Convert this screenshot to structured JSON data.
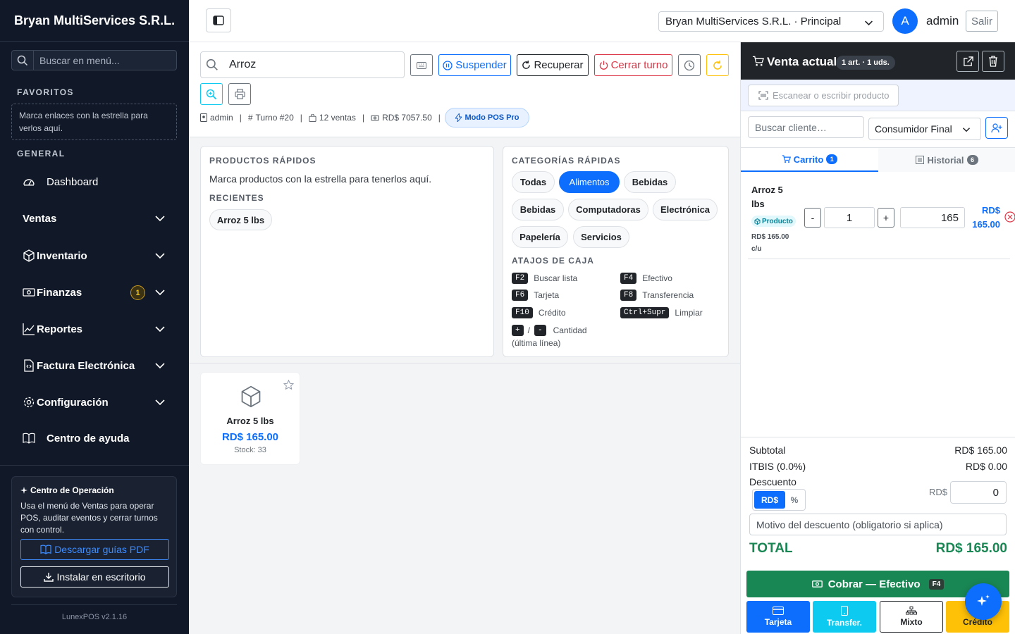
{
  "sidebar": {
    "brand": "Bryan MultiServices S.R.L.",
    "search_placeholder": "Buscar en menú...",
    "favorites_title": "FAVORITOS",
    "favorites_hint": "Marca enlaces con la estrella para verlos aquí.",
    "general_title": "GENERAL",
    "items": [
      {
        "label": "Dashboard",
        "icon": "gauge-icon"
      },
      {
        "label": "Ventas",
        "icon": null
      },
      {
        "label": "Inventario",
        "icon": "box-icon"
      },
      {
        "label": "Finanzas",
        "icon": "cash-icon",
        "badge": "1"
      },
      {
        "label": "Reportes",
        "icon": "chart-line-icon"
      },
      {
        "label": "Factura Electrónica",
        "icon": "file-code-icon"
      },
      {
        "label": "Configuración",
        "icon": "gear-icon"
      },
      {
        "label": "Centro de ayuda",
        "icon": "book-icon"
      }
    ],
    "ops": {
      "title": "Centro de Operación",
      "text": "Usa el menú de Ventas para operar POS, auditar eventos y cerrar turnos con control.",
      "pdf_button": "Descargar guías PDF",
      "install_button": "Instalar en escritorio"
    },
    "version": "LunexPOS v2.1.16"
  },
  "topbar": {
    "company": "Bryan MultiServices S.R.L. · Principal",
    "avatar_letter": "A",
    "user": "admin",
    "logout": "Salir"
  },
  "toolbar": {
    "search_value": "Arroz",
    "suspend": "Suspender",
    "recover": "Recuperar",
    "close_shift": "Cerrar turno",
    "info": {
      "user": "admin",
      "shift": "Turno #20",
      "sales": "12 ventas",
      "amount": "RD$ 7057.50",
      "sep": "|"
    },
    "pro_mode": "Modo POS Pro"
  },
  "quick_products": {
    "title": "PRODUCTOS RÁPIDOS",
    "hint": "Marca productos con la estrella para tenerlos aquí.",
    "recent_title": "RECIENTES",
    "recent": [
      "Arroz 5 lbs"
    ]
  },
  "categories": {
    "title": "CATEGORÍAS RÁPIDAS",
    "items": [
      "Todas",
      "Alimentos",
      "Bebidas",
      "Bebidas",
      "Computadoras",
      "Electrónica",
      "Papelería",
      "Servicios"
    ],
    "active": "Alimentos"
  },
  "shortcuts": {
    "title": "ATAJOS DE CAJA",
    "items": [
      {
        "key": "F2",
        "label": "Buscar lista"
      },
      {
        "key": "F4",
        "label": "Efectivo"
      },
      {
        "key": "F6",
        "label": "Tarjeta"
      },
      {
        "key": "F8",
        "label": "Transferencia"
      },
      {
        "key": "F10",
        "label": "Crédito"
      },
      {
        "key": "Ctrl+Supr",
        "label": "Limpiar"
      }
    ],
    "qty": {
      "plus": "+",
      "slash": "/",
      "minus": "-",
      "label": "Cantidad",
      "sub": "(última línea)"
    }
  },
  "product_grid": [
    {
      "name": "Arroz 5 lbs",
      "price": "RD$ 165.00",
      "stock": "Stock: 33"
    }
  ],
  "sale": {
    "title": "Venta actual",
    "summary": "1 art. · 1 uds.",
    "scan_placeholder": "Escanear o escribir producto",
    "customer_placeholder": "Buscar cliente…",
    "customer_type": "Consumidor Final",
    "tabs": [
      {
        "label": "Carrito",
        "count": "1"
      },
      {
        "label": "Historial",
        "count": "6"
      }
    ],
    "line": {
      "name_1": "Arroz 5",
      "name_2": "lbs",
      "type": "Producto",
      "unit_price": "RD$ 165.00",
      "unit": "c/u",
      "minus": "-",
      "plus": "+",
      "qty": "1",
      "price": "165",
      "total_1": "RD$",
      "total_2": "165.00"
    },
    "totals": {
      "subtotal_label": "Subtotal",
      "subtotal": "RD$ 165.00",
      "itbis_label": "ITBIS (0.0%)",
      "itbis": "RD$ 0.00",
      "discount_label": "Descuento",
      "disc_mode_amount": "RD$",
      "disc_mode_pct": "%",
      "disc_currency": "RD$",
      "disc_value": "0",
      "reason_placeholder": "Motivo del descuento (obligatorio si aplica)",
      "total_label": "TOTAL",
      "total": "RD$ 165.00"
    },
    "charge": {
      "label": "Cobrar — Efectivo",
      "key": "F4"
    },
    "pay_methods": [
      "Tarjeta",
      "Transfer.",
      "Mixto",
      "Crédito"
    ]
  },
  "colors": {
    "primary": "#0d6efd",
    "success": "#198754",
    "info": "#0dcaf0",
    "warning": "#ffc107",
    "danger": "#dc3545",
    "dark": "#111827"
  }
}
